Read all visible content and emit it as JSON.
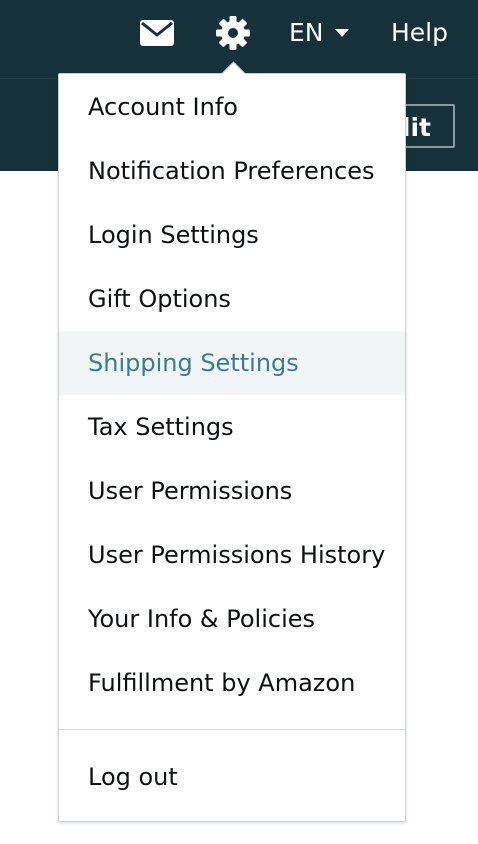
{
  "header": {
    "language": "EN",
    "help": "Help",
    "partial_button_text": "lit"
  },
  "icons": {
    "mail": "mail-icon",
    "gear": "gear-icon",
    "caret": "caret-down-icon"
  },
  "colors": {
    "header_bg": "#16313a",
    "active_text": "#377f8a",
    "active_bg": "#f1f5f5",
    "text": "#0f1111"
  },
  "menu": {
    "items": [
      {
        "label": "Account Info"
      },
      {
        "label": "Notification Preferences"
      },
      {
        "label": "Login Settings"
      },
      {
        "label": "Gift Options"
      },
      {
        "label": "Shipping Settings",
        "active": true
      },
      {
        "label": "Tax Settings"
      },
      {
        "label": "User Permissions"
      },
      {
        "label": "User Permissions History"
      },
      {
        "label": "Your Info & Policies"
      },
      {
        "label": "Fulfillment by Amazon"
      }
    ],
    "logout": "Log out"
  }
}
